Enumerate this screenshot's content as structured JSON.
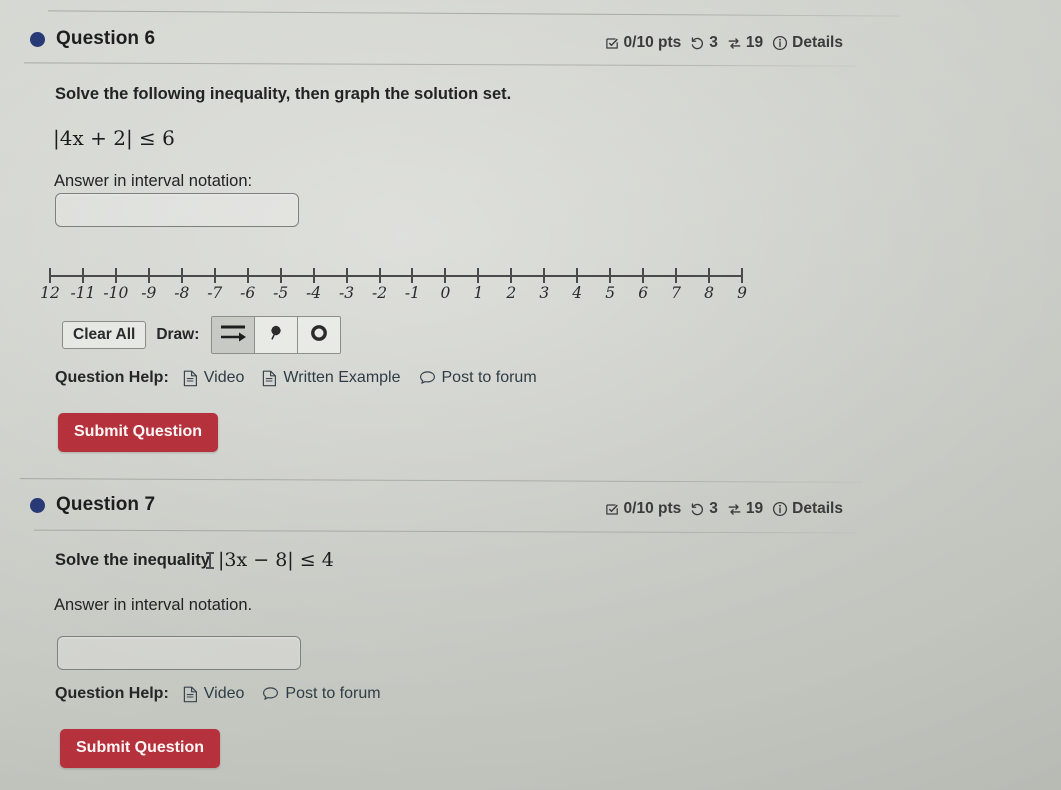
{
  "questions": [
    {
      "title": "Question 6",
      "points": "0/10 pts",
      "attempts": "3",
      "reattempts": "19",
      "details": "Details",
      "prompt": "Solve the following inequality, then graph the solution set.",
      "math": "|4x + 2| ≤ 6",
      "answer_label": "Answer in interval notation:",
      "answer_value": "",
      "answer_placeholder": "",
      "clear_all": "Clear All",
      "draw_label": "Draw:",
      "tools": [
        {
          "name": "ray-tool",
          "label": "Ray",
          "selected": true
        },
        {
          "name": "closed-dot-tool",
          "label": "Closed dot",
          "selected": false
        },
        {
          "name": "open-dot-tool",
          "label": "Open dot",
          "selected": false
        }
      ],
      "help_label": "Question Help:",
      "help_links": [
        {
          "icon": "document-icon",
          "label": "Video"
        },
        {
          "icon": "document-icon",
          "label": "Written Example"
        },
        {
          "icon": "speech-bubble-icon",
          "label": "Post to forum"
        }
      ],
      "submit": "Submit Question"
    },
    {
      "title": "Question 7",
      "points": "0/10 pts",
      "attempts": "3",
      "reattempts": "19",
      "details": "Details",
      "prompt_prefix": "Solve the inequality",
      "math": "|3x − 8| ≤ 4",
      "answer_label": "Answer in interval notation.",
      "answer_value": "",
      "answer_placeholder": "",
      "help_label": "Question Help:",
      "help_links": [
        {
          "icon": "document-icon",
          "label": "Video"
        },
        {
          "icon": "speech-bubble-icon",
          "label": "Post to forum"
        }
      ],
      "submit": "Submit Question"
    }
  ],
  "number_line": {
    "min": -12,
    "max": 9,
    "labels": [
      "12",
      "-11",
      "-10",
      "-9",
      "-8",
      "-7",
      "-6",
      "-5",
      "-4",
      "-3",
      "-2",
      "-1",
      "0",
      "1",
      "2",
      "3",
      "4",
      "5",
      "6",
      "7",
      "8",
      "9"
    ]
  },
  "colors": {
    "accent_dot": "#283a75",
    "submit_button": "#b5323c",
    "page_background": "#c9cbc5"
  }
}
